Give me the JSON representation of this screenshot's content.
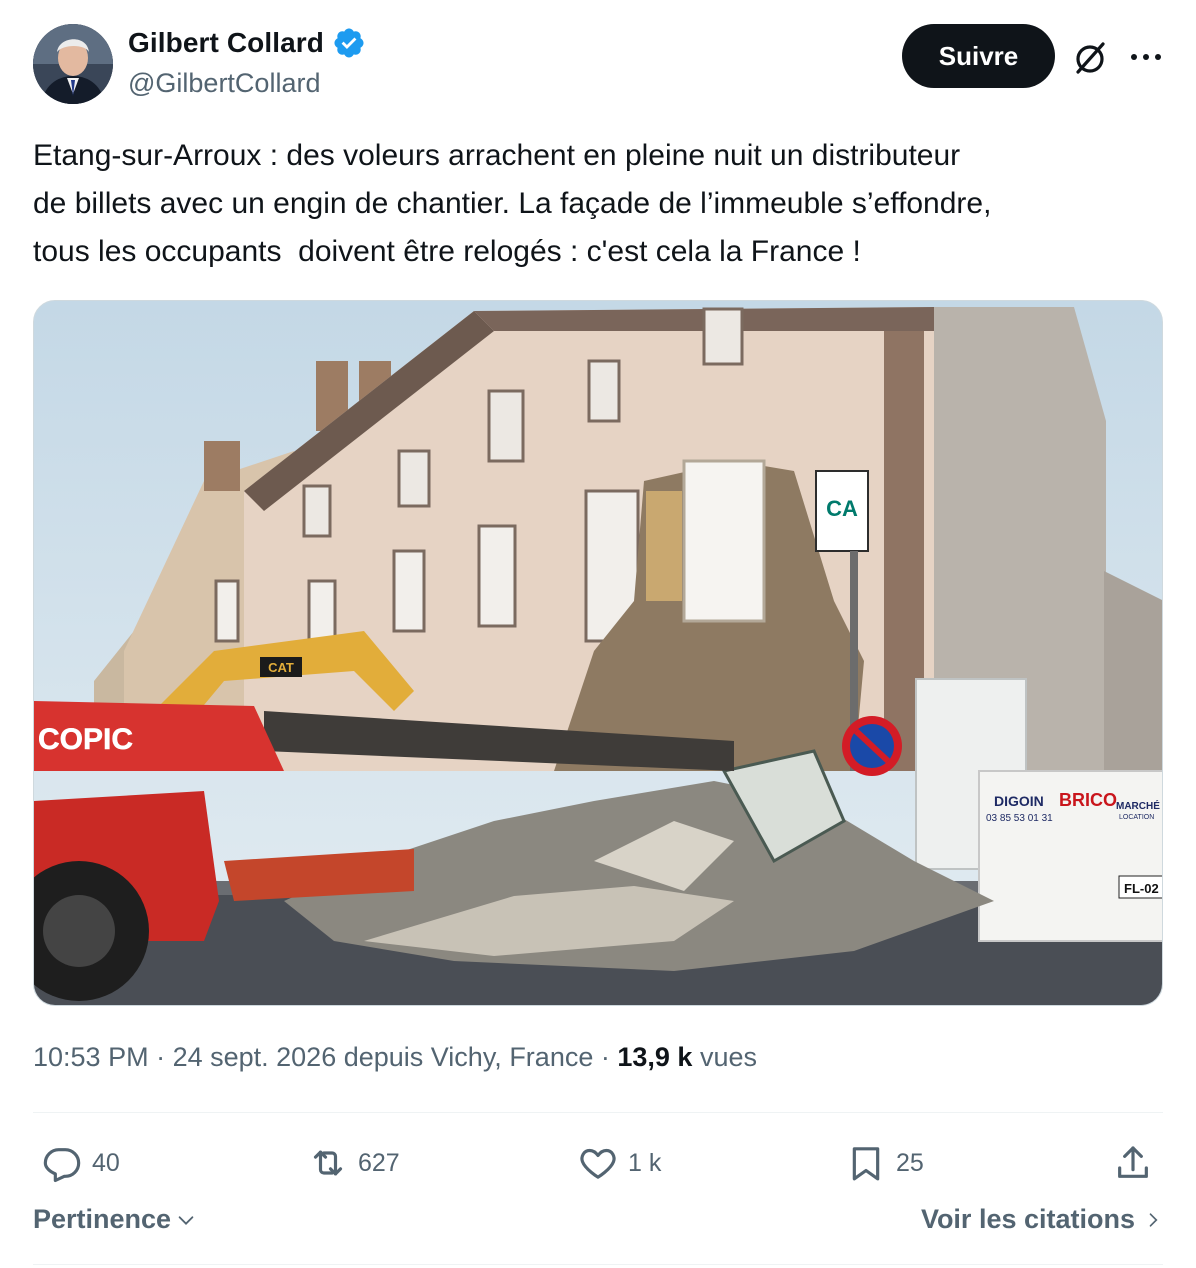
{
  "author": {
    "name": "Gilbert Collard",
    "handle": "@GilbertCollard",
    "verified": true
  },
  "header": {
    "follow_label": "Suivre",
    "grok_icon": "grok-icon",
    "more_icon": "more-horizontal-icon"
  },
  "tweet": {
    "text": "Etang-sur-Arroux : des voleurs arrachent en pleine nuit un distributeur\nde billets avec un engin de chantier. La façade de l’immeuble s’effondre,\ntous les occupants  doivent être relogés : c'est cela la France !"
  },
  "photo": {
    "sign_copic": "COPIC",
    "sign_cat": "CAT",
    "sign_ca": "CA",
    "truck_digoin": "DIGOIN",
    "truck_phone": "03 85 53 01 31",
    "truck_brico": "BRICO",
    "truck_marche": "MARCHÉ",
    "truck_location": "LOCATION",
    "plate": "FL-02"
  },
  "meta": {
    "time": "10:53 PM",
    "sep1": " · ",
    "date_source": "24 sept. 2026 depuis Vichy, France",
    "sep2": " · ",
    "views_count": "13,9 k",
    "views_label": " vues"
  },
  "actions": {
    "replies": "40",
    "reposts": "627",
    "likes": "1 k",
    "bookmarks": "25"
  },
  "footer": {
    "sort_label": "Pertinence",
    "quotes_label": "Voir les citations"
  },
  "colors": {
    "text": "#0f1419",
    "secondary": "#536471",
    "verified_blue": "#1d9bf0",
    "follow_bg": "#0f1419"
  }
}
